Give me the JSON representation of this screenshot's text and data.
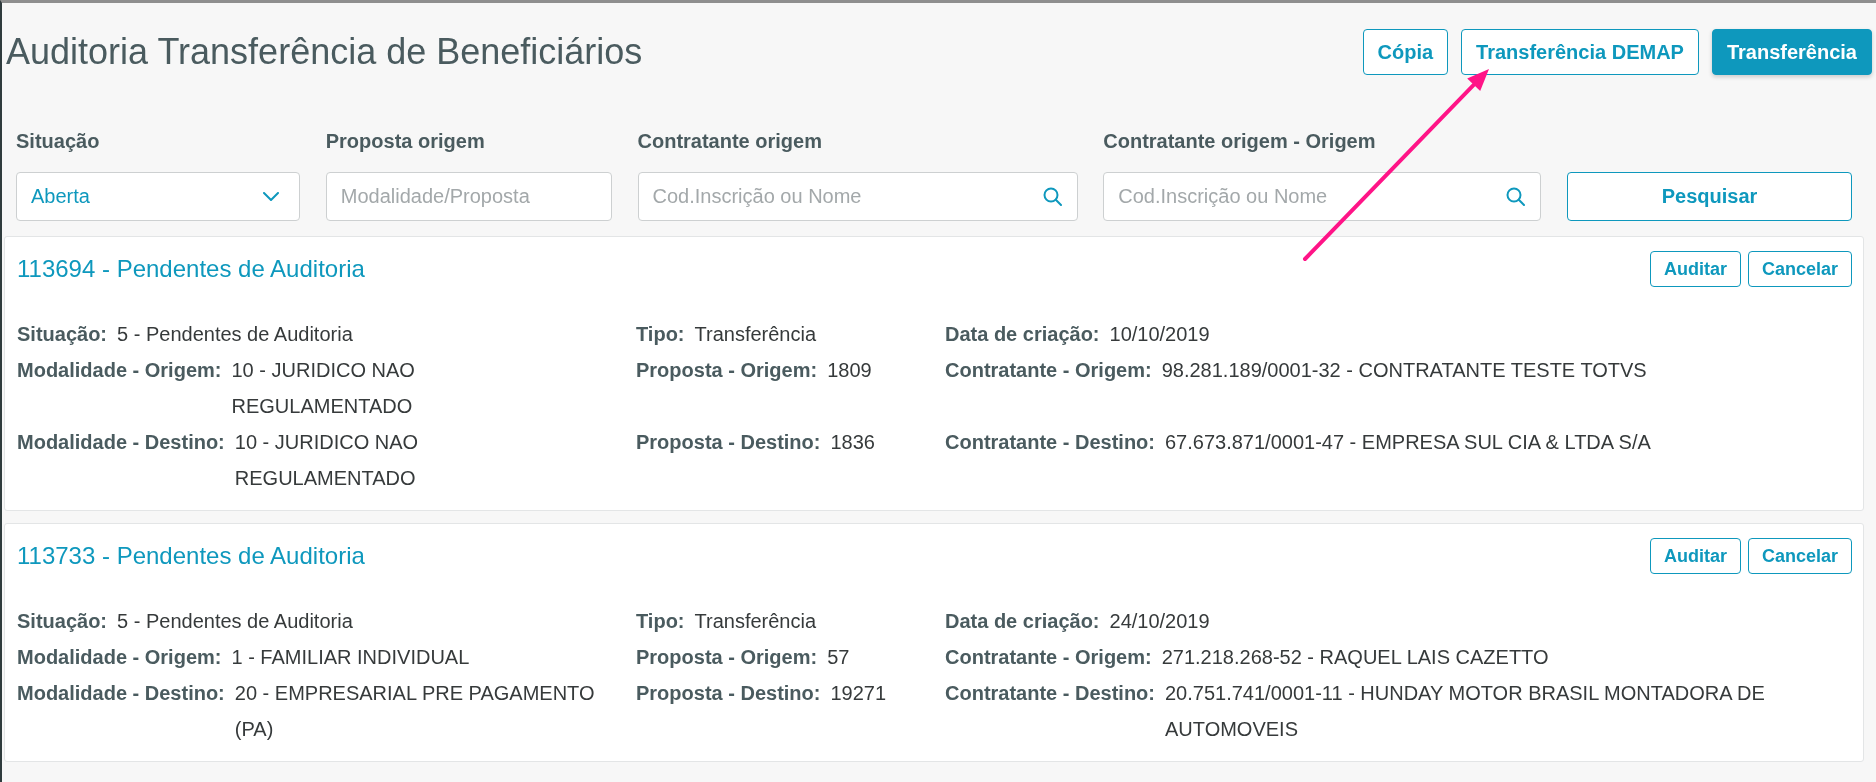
{
  "page_title": "Auditoria Transferência de Beneficiários",
  "header_buttons": [
    {
      "label": "Cópia",
      "kind": "outline"
    },
    {
      "label": "Transferência DEMAP",
      "kind": "outline"
    },
    {
      "label": "Transferência",
      "kind": "primary"
    }
  ],
  "filters": [
    {
      "label": "Situação",
      "kind": "select",
      "value": "Aberta"
    },
    {
      "label": "Proposta origem",
      "kind": "text",
      "placeholder": "Modalidade/Proposta"
    },
    {
      "label": "Contratante origem",
      "kind": "search",
      "placeholder": "Cod.Inscrição ou Nome"
    },
    {
      "label": "Contratante origem - Origem",
      "kind": "search",
      "placeholder": "Cod.Inscrição ou Nome"
    }
  ],
  "search_button": "Pesquisar",
  "cards": [
    {
      "title": "113694 - Pendentes de Auditoria",
      "actions": [
        "Auditar",
        "Cancelar"
      ],
      "rows": [
        [
          {
            "label": "Situação:",
            "value": "5 - Pendentes de Auditoria"
          },
          {
            "label": "Tipo:",
            "value": "Transferência"
          },
          {
            "label": "Data de criação:",
            "value": "10/10/2019"
          }
        ],
        [
          {
            "label": "Modalidade - Origem:",
            "value": "10 - JURIDICO NAO REGULAMENTADO"
          },
          {
            "label": "Proposta - Origem:",
            "value": "1809"
          },
          {
            "label": "Contratante - Origem:",
            "value": "98.281.189/0001-32 - CONTRATANTE TESTE TOTVS"
          }
        ],
        [
          {
            "label": "Modalidade - Destino:",
            "value": "10 - JURIDICO NAO REGULAMENTADO"
          },
          {
            "label": "Proposta - Destino:",
            "value": "1836"
          },
          {
            "label": "Contratante - Destino:",
            "value": "67.673.871/0001-47 - EMPRESA SUL CIA & LTDA S/A"
          }
        ]
      ]
    },
    {
      "title": "113733 - Pendentes de Auditoria",
      "actions": [
        "Auditar",
        "Cancelar"
      ],
      "rows": [
        [
          {
            "label": "Situação:",
            "value": "5 - Pendentes de Auditoria"
          },
          {
            "label": "Tipo:",
            "value": "Transferência"
          },
          {
            "label": "Data de criação:",
            "value": "24/10/2019"
          }
        ],
        [
          {
            "label": "Modalidade - Origem:",
            "value": "1 - FAMILIAR INDIVIDUAL"
          },
          {
            "label": "Proposta - Origem:",
            "value": "57"
          },
          {
            "label": "Contratante - Origem:",
            "value": "271.218.268-52 - RAQUEL LAIS CAZETTO"
          }
        ],
        [
          {
            "label": "Modalidade - Destino:",
            "value": "20 - EMPRESARIAL PRE PAGAMENTO (PA)"
          },
          {
            "label": "Proposta - Destino:",
            "value": "19271"
          },
          {
            "label": "Contratante - Destino:",
            "value": "20.751.741/0001-11 - HUNDAY MOTOR BRASIL MONTADORA DE AUTOMOVEIS"
          }
        ]
      ]
    }
  ]
}
